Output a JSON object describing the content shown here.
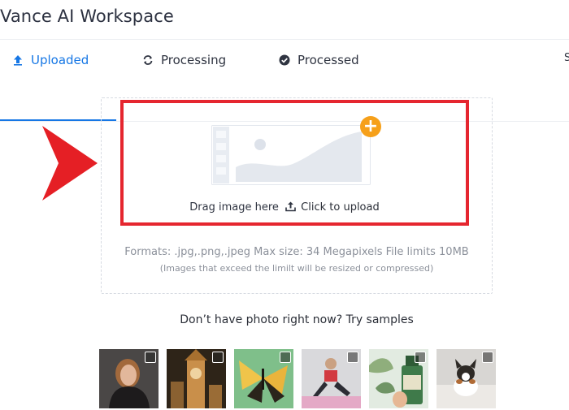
{
  "app": {
    "title": "Vance AI Workspace"
  },
  "tabs": [
    {
      "label": "Uploaded",
      "icon": "upload-arrow-icon",
      "active": true
    },
    {
      "label": "Processing",
      "icon": "refresh-icon",
      "active": false
    },
    {
      "label": "Processed",
      "icon": "check-circle-icon",
      "active": false
    }
  ],
  "tab_overflow": "S",
  "upload": {
    "drag_text": "Drag image here",
    "click_text": "Click to upload",
    "formats": "Formats: .jpg,.png,.jpeg Max size: 34 Megapixels File limits 10MB",
    "note": "(Images that exceed the limilt will be resized or compressed)"
  },
  "samples": {
    "title": "Don’t have photo right now? Try samples",
    "items": [
      {
        "name": "portrait"
      },
      {
        "name": "clock-tower"
      },
      {
        "name": "butterfly"
      },
      {
        "name": "fitness"
      },
      {
        "name": "skincare-bottle"
      },
      {
        "name": "dog-in-snow"
      }
    ]
  },
  "colors": {
    "accent": "#1677e5",
    "highlight": "#e5262f",
    "badge": "#f6a01a",
    "arrow": "#e51f25"
  }
}
